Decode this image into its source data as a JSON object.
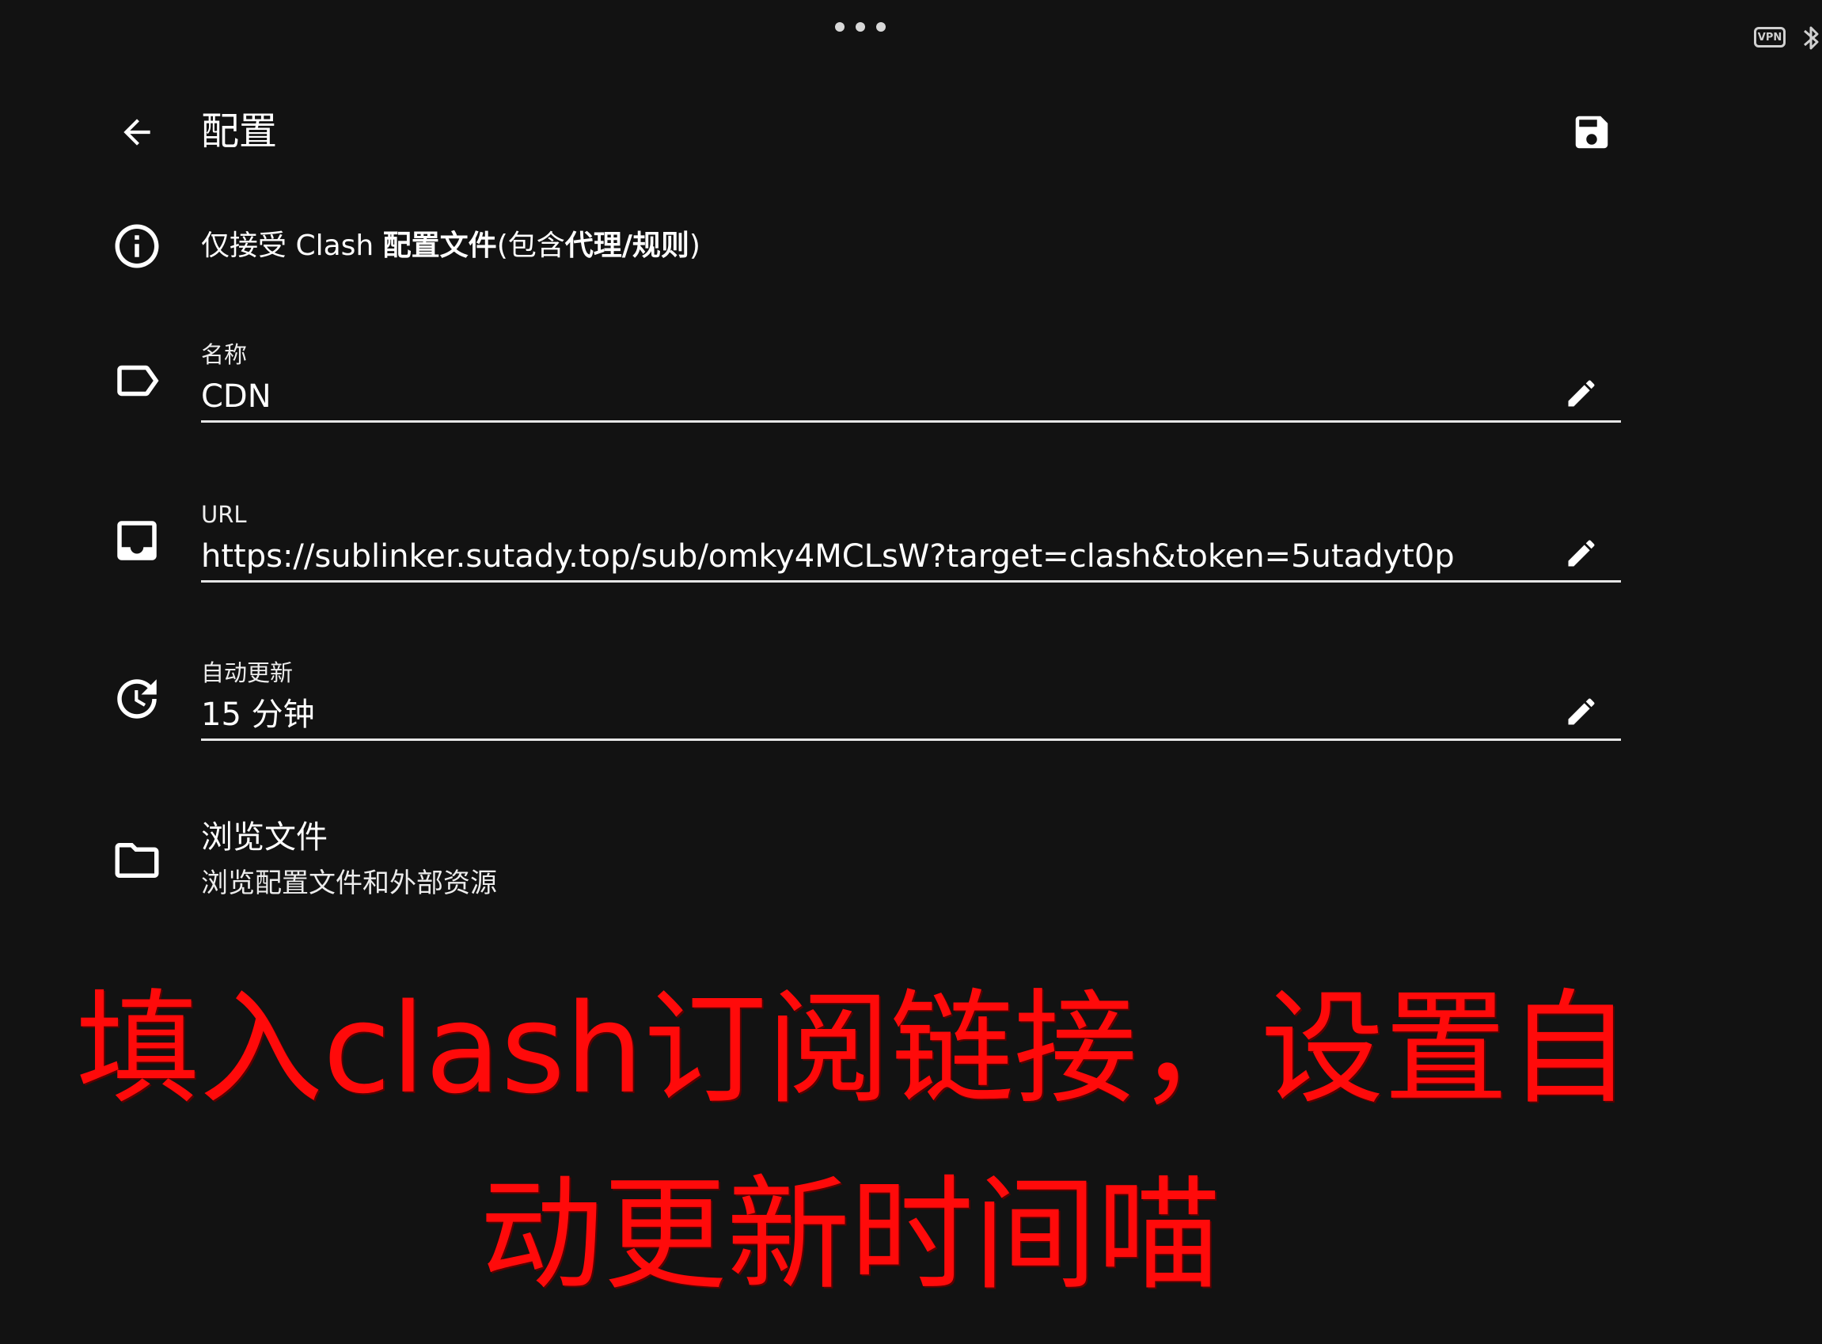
{
  "status_bar": {
    "vpn_label": "VPN"
  },
  "toolbar": {
    "title": "配置",
    "back_icon": "arrow-left-icon",
    "save_icon": "save-icon"
  },
  "info": {
    "prefix": "仅接受 Clash ",
    "bold_1": "配置文件",
    "mid_1": "(包含",
    "bold_2": "代理",
    "mid_2": "/",
    "bold_3": "规则",
    "suffix": ")"
  },
  "fields": {
    "name": {
      "label": "名称",
      "value": "CDN",
      "icon": "label-tag-icon"
    },
    "url": {
      "label": "URL",
      "value": "https://sublinker.sutady.top/sub/omky4MCLsW?target=clash&token=5utadyt0p",
      "icon": "inbox-icon"
    },
    "auto_update": {
      "label": "自动更新",
      "value": "15 分钟",
      "icon": "update-clock-icon"
    }
  },
  "files": {
    "title": "浏览文件",
    "subtitle": "浏览配置文件和外部资源",
    "icon": "folder-icon"
  },
  "overlay": {
    "line1": "填入clash订阅链接，设置自",
    "line2": "动更新时间喵",
    "color": "#ff0a0a"
  }
}
